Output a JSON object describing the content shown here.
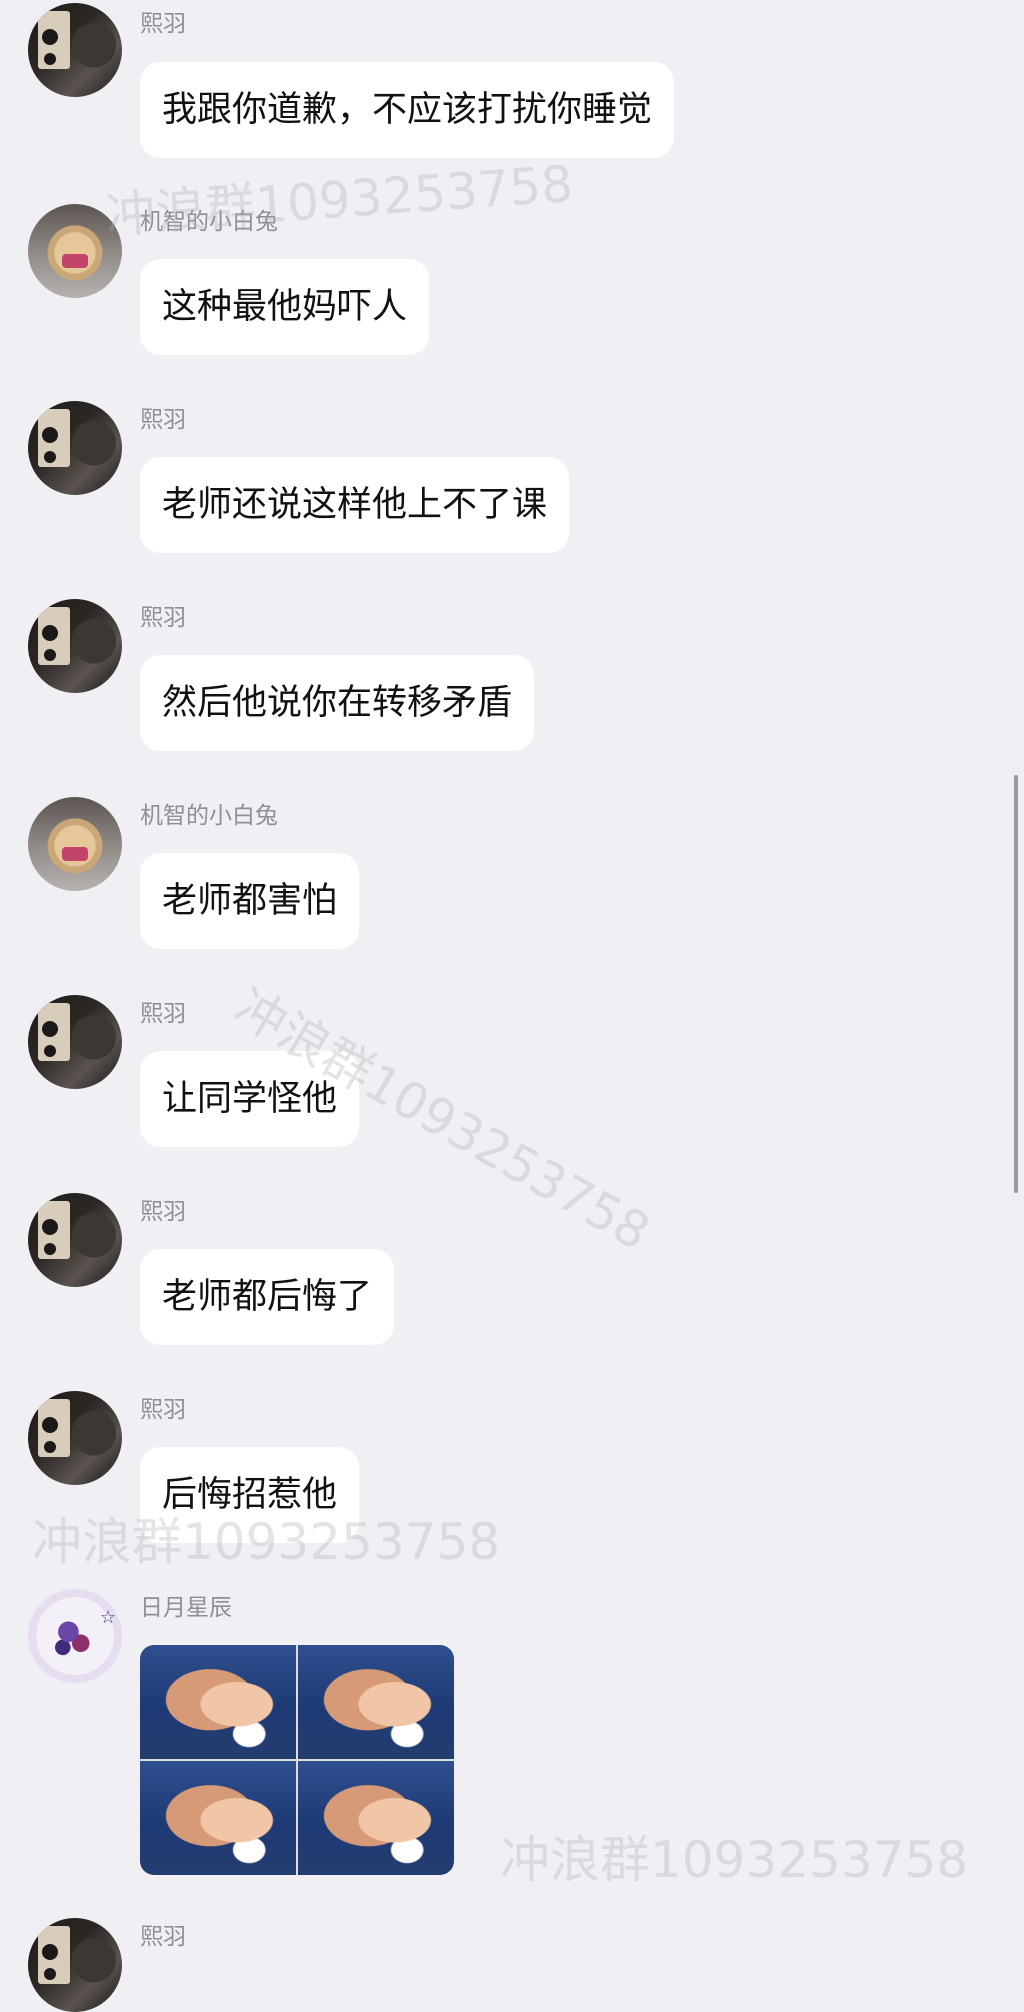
{
  "messages": [
    {
      "sender": "熙羽",
      "text": "我跟你道歉，不应该打扰你睡觉"
    },
    {
      "sender": "机智的小白兔",
      "text": "这种最他妈吓人"
    },
    {
      "sender": "熙羽",
      "text": "老师还说这样他上不了课"
    },
    {
      "sender": "熙羽",
      "text": "然后他说你在转移矛盾"
    },
    {
      "sender": "机智的小白兔",
      "text": "老师都害怕"
    },
    {
      "sender": "熙羽",
      "text": "让同学怪他"
    },
    {
      "sender": "熙羽",
      "text": "老师都后悔了"
    },
    {
      "sender": "熙羽",
      "text": "后悔招惹他"
    },
    {
      "sender": "日月星辰",
      "text": ""
    },
    {
      "sender": "熙羽",
      "text": ""
    }
  ],
  "watermark": {
    "text": "冲浪群1093253758"
  },
  "colors": {
    "background": "#efeff4",
    "bubble": "#ffffff",
    "name": "#8e8e93"
  }
}
